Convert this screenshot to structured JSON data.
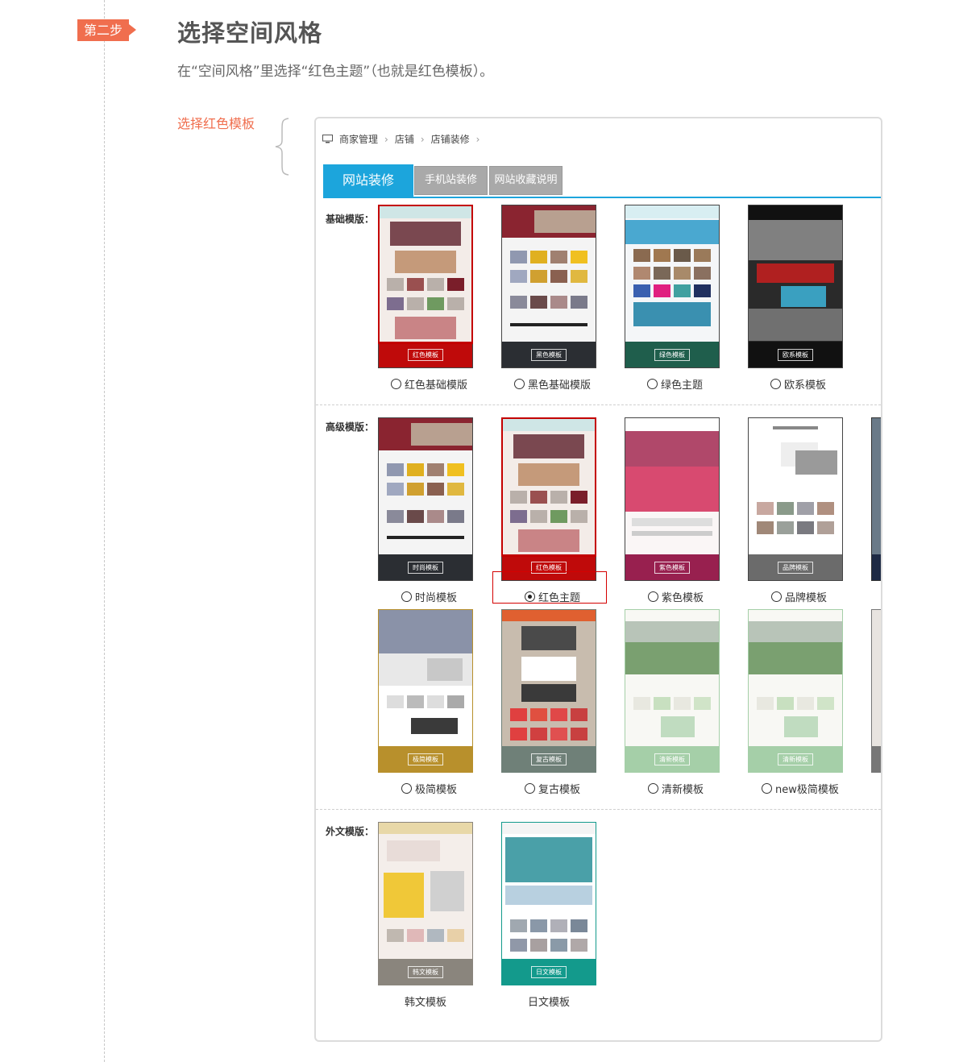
{
  "step": {
    "badge": "第二步",
    "title": "选择空间风格",
    "description": "在“空间风格”里选择“红色主题”（也就是红色模板）。",
    "side_label": "选择红色模板"
  },
  "breadcrumb": {
    "items": [
      "商家管理",
      "店铺",
      "店铺装修"
    ],
    "separator": "›"
  },
  "tabs": [
    {
      "label": "网站装修",
      "active": true
    },
    {
      "label": "手机站装修",
      "active": false
    },
    {
      "label": "网站收藏说明",
      "active": false
    }
  ],
  "sections": {
    "basic": "基础模版：",
    "advanced": "高级模版：",
    "foreign": "外文模版："
  },
  "basic_templates": [
    {
      "caption": "红色基础模版",
      "button": "红色模板",
      "band_color": "#bf0a0a",
      "selected": false
    },
    {
      "caption": "黑色基础模版",
      "button": "黑色模板",
      "band_color": "#2b2e33",
      "selected": false
    },
    {
      "caption": "绿色主题",
      "button": "绿色模板",
      "band_color": "#1f5e4c",
      "selected": false
    },
    {
      "caption": "欧系模板",
      "button": "欧系模板",
      "band_color": "#111111",
      "selected": false
    }
  ],
  "advanced_templates_row1": [
    {
      "caption": "时尚模板",
      "button": "时尚模板",
      "band_color": "#2b2e33",
      "selected": false
    },
    {
      "caption": "红色主题",
      "button": "红色模板",
      "band_color": "#bf0a0a",
      "selected": true
    },
    {
      "caption": "紫色模板",
      "button": "紫色模板",
      "band_color": "#98204f",
      "selected": false
    },
    {
      "caption": "品牌模板",
      "button": "品牌模板",
      "band_color": "#6b6b6b",
      "selected": false
    }
  ],
  "advanced_templates_row2": [
    {
      "caption": "极简模板",
      "button": "极简模板",
      "band_color": "#b8902c",
      "selected": false
    },
    {
      "caption": "复古模板",
      "button": "复古模板",
      "band_color": "#6f8078",
      "selected": false
    },
    {
      "caption": "清新模板",
      "button": "清新模板",
      "band_color": "#a5cfa8",
      "selected": false
    },
    {
      "caption": "new极简模板",
      "button": "清新模板",
      "band_color": "#a5cfa8",
      "selected": false
    }
  ],
  "foreign_templates": [
    {
      "caption": "韩文模板",
      "button": "韩文模板",
      "band_color": "#8a857d"
    },
    {
      "caption": "日文模板",
      "button": "日文模板",
      "band_color": "#139a8c"
    }
  ],
  "colors": {
    "accent_orange": "#f06e4e",
    "tab_blue": "#1ca5dc",
    "highlight_red": "#d40000"
  }
}
